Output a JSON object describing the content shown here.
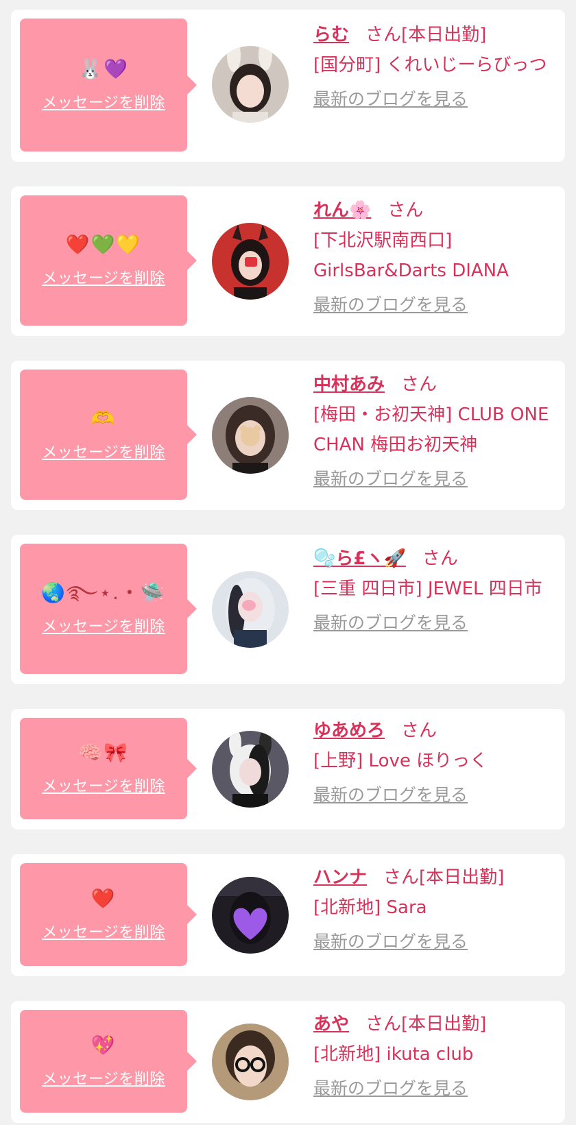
{
  "delete_label": "メッセージを削除",
  "san_label": "さん",
  "blog_label": "最新のブログを見る",
  "entries": [
    {
      "emoji": "🐰💜",
      "name": "らむ",
      "status": "[本日出勤]",
      "shop": "[国分町] くれいじーらびっつ"
    },
    {
      "emoji": "❤️💚💛",
      "name": "れん🌸",
      "status": "",
      "shop": "[下北沢駅南西口] GirlsBar&Darts DIANA"
    },
    {
      "emoji": "🫶",
      "name": "中村あみ",
      "status": "",
      "shop": "[梅田・お初天神] CLUB ONE CHAN 梅田お初天神"
    },
    {
      "emoji": "🌏࿐⋆.・🛸",
      "name": "🫧ら£ヽ🚀",
      "status": "",
      "shop": "[三重 四日市] JEWEL 四日市"
    },
    {
      "emoji": "🧠🎀",
      "name": "ゆあめろ",
      "status": "",
      "shop": "[上野] Love ほりっく"
    },
    {
      "emoji": "❤️",
      "name": "ハンナ",
      "status": "[本日出勤]",
      "shop": "[北新地] Sara"
    },
    {
      "emoji": "💖",
      "name": "あや",
      "status": "[本日出勤]",
      "shop": "[北新地] ikuta club"
    }
  ]
}
